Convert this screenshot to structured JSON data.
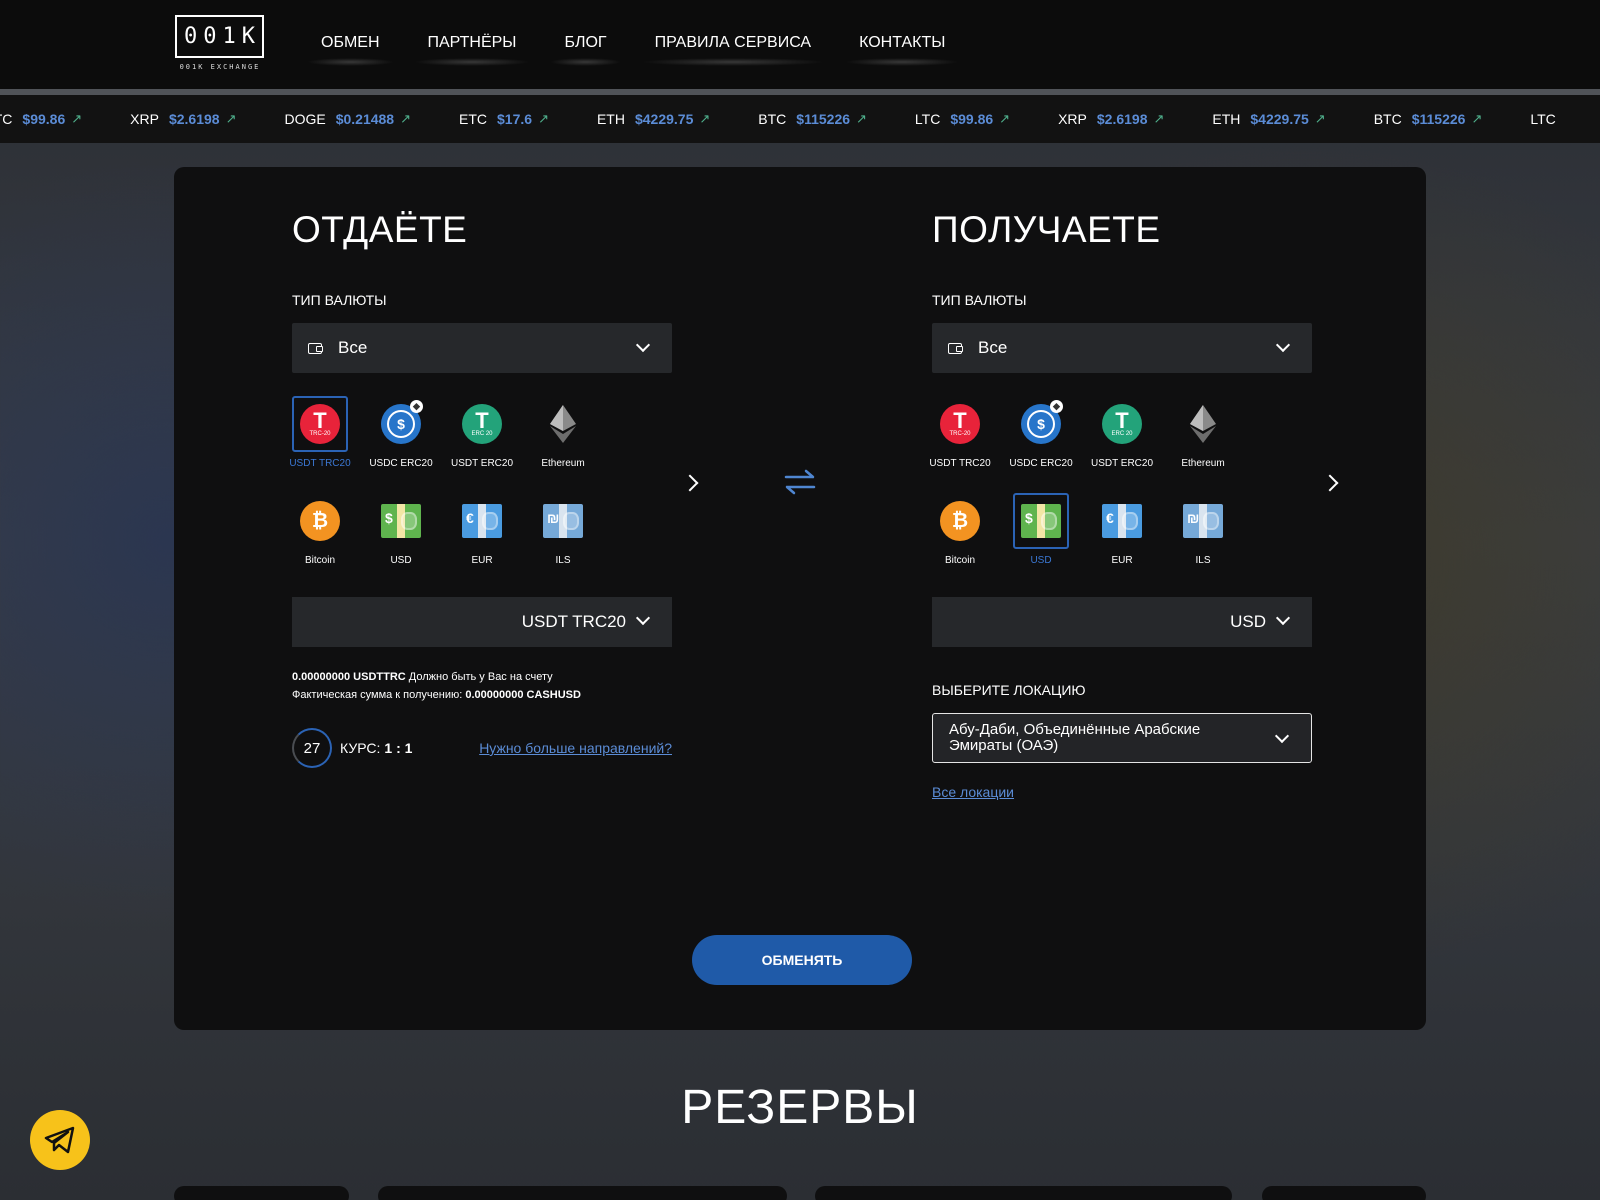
{
  "header": {
    "logo_text": "001K",
    "logo_sub": "001K EXCHANGE",
    "nav": [
      "ОБМЕН",
      "ПАРТНЁРЫ",
      "БЛОГ",
      "ПРАВИЛА СЕРВИСА",
      "КОНТАКТЫ"
    ]
  },
  "ticker": [
    {
      "sym": "LTC",
      "price": "$99.86"
    },
    {
      "sym": "XRP",
      "price": "$2.6198"
    },
    {
      "sym": "DOGE",
      "price": "$0.21488"
    },
    {
      "sym": "ETC",
      "price": "$17.6"
    },
    {
      "sym": "ETH",
      "price": "$4229.75"
    },
    {
      "sym": "BTC",
      "price": "$115226"
    },
    {
      "sym": "LTC",
      "price": "$99.86"
    },
    {
      "sym": "XRP",
      "price": "$2.6198"
    },
    {
      "sym": "ETH",
      "price": "$4229.75"
    },
    {
      "sym": "BTC",
      "price": "$115226"
    },
    {
      "sym": "LTC",
      "price": ""
    }
  ],
  "give": {
    "title": "ОТДАЁТЕ",
    "type_label": "ТИП ВАЛЮТЫ",
    "type_value": "Все",
    "currencies": [
      "USDT TRC20",
      "USDC ERC20",
      "USDT ERC20",
      "Ethereum",
      "Bitcoin",
      "USD",
      "EUR",
      "ILS"
    ],
    "selected": "USDT TRC20",
    "amount_currency": "USDT TRC20",
    "info_line1_amount": "0.00000000 USDTTRC",
    "info_line1_text": " Должно быть у Вас на счету",
    "info_line2_text": "Фактическая сумма к получению: ",
    "info_line2_amount": "0.00000000 CASHUSD",
    "timer": "27",
    "rate_label": "КУРС:",
    "rate_value": "1  : 1",
    "more_link": "Нужно больше направлений?"
  },
  "get": {
    "title": "ПОЛУЧАЕТЕ",
    "type_label": "ТИП ВАЛЮТЫ",
    "type_value": "Все",
    "currencies": [
      "USDT TRC20",
      "USDC ERC20",
      "USDT ERC20",
      "Ethereum",
      "Bitcoin",
      "USD",
      "EUR",
      "ILS"
    ],
    "selected": "USD",
    "amount_currency": "USD",
    "location_label": "ВЫБЕРИТЕ ЛОКАЦИЮ",
    "location_value": "Абу-Даби, Объединённые Арабские Эмираты (ОАЭ)",
    "all_locations": "Все локации"
  },
  "exchange_button": "ОБМЕНЯТЬ",
  "reserves_title": "РЕЗЕРВЫ",
  "colors": {
    "accent": "#1f5aa8",
    "link": "#5b8cd6",
    "telegram": "#f7c21a"
  }
}
